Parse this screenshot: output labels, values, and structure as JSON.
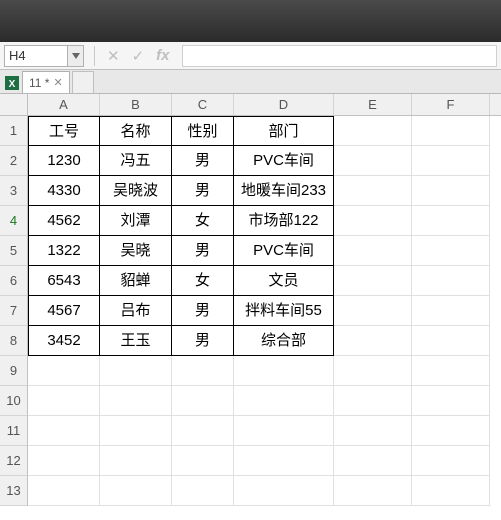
{
  "formula_bar": {
    "name_box_value": "H4",
    "cancel_glyph": "✕",
    "confirm_glyph": "✓",
    "fx_label": "fx"
  },
  "sheet_tab": {
    "label": "11 *"
  },
  "columns": [
    "A",
    "B",
    "C",
    "D",
    "E",
    "F"
  ],
  "row_numbers": [
    "1",
    "2",
    "3",
    "4",
    "5",
    "6",
    "7",
    "8",
    "9",
    "10",
    "11",
    "12",
    "13"
  ],
  "active_row": 4,
  "table": {
    "headers": [
      "工号",
      "名称",
      "性别",
      "部门"
    ],
    "rows": [
      [
        "1230",
        "冯五",
        "男",
        "PVC车间"
      ],
      [
        "4330",
        "吴晓波",
        "男",
        "地暖车间233"
      ],
      [
        "4562",
        "刘潭",
        "女",
        "市场部122"
      ],
      [
        "1322",
        "吴晓",
        "男",
        "PVC车间"
      ],
      [
        "6543",
        "貂蝉",
        "女",
        "文员"
      ],
      [
        "4567",
        "吕布",
        "男",
        "拌料车间55"
      ],
      [
        "3452",
        "王玉",
        "男",
        "综合部"
      ]
    ]
  }
}
